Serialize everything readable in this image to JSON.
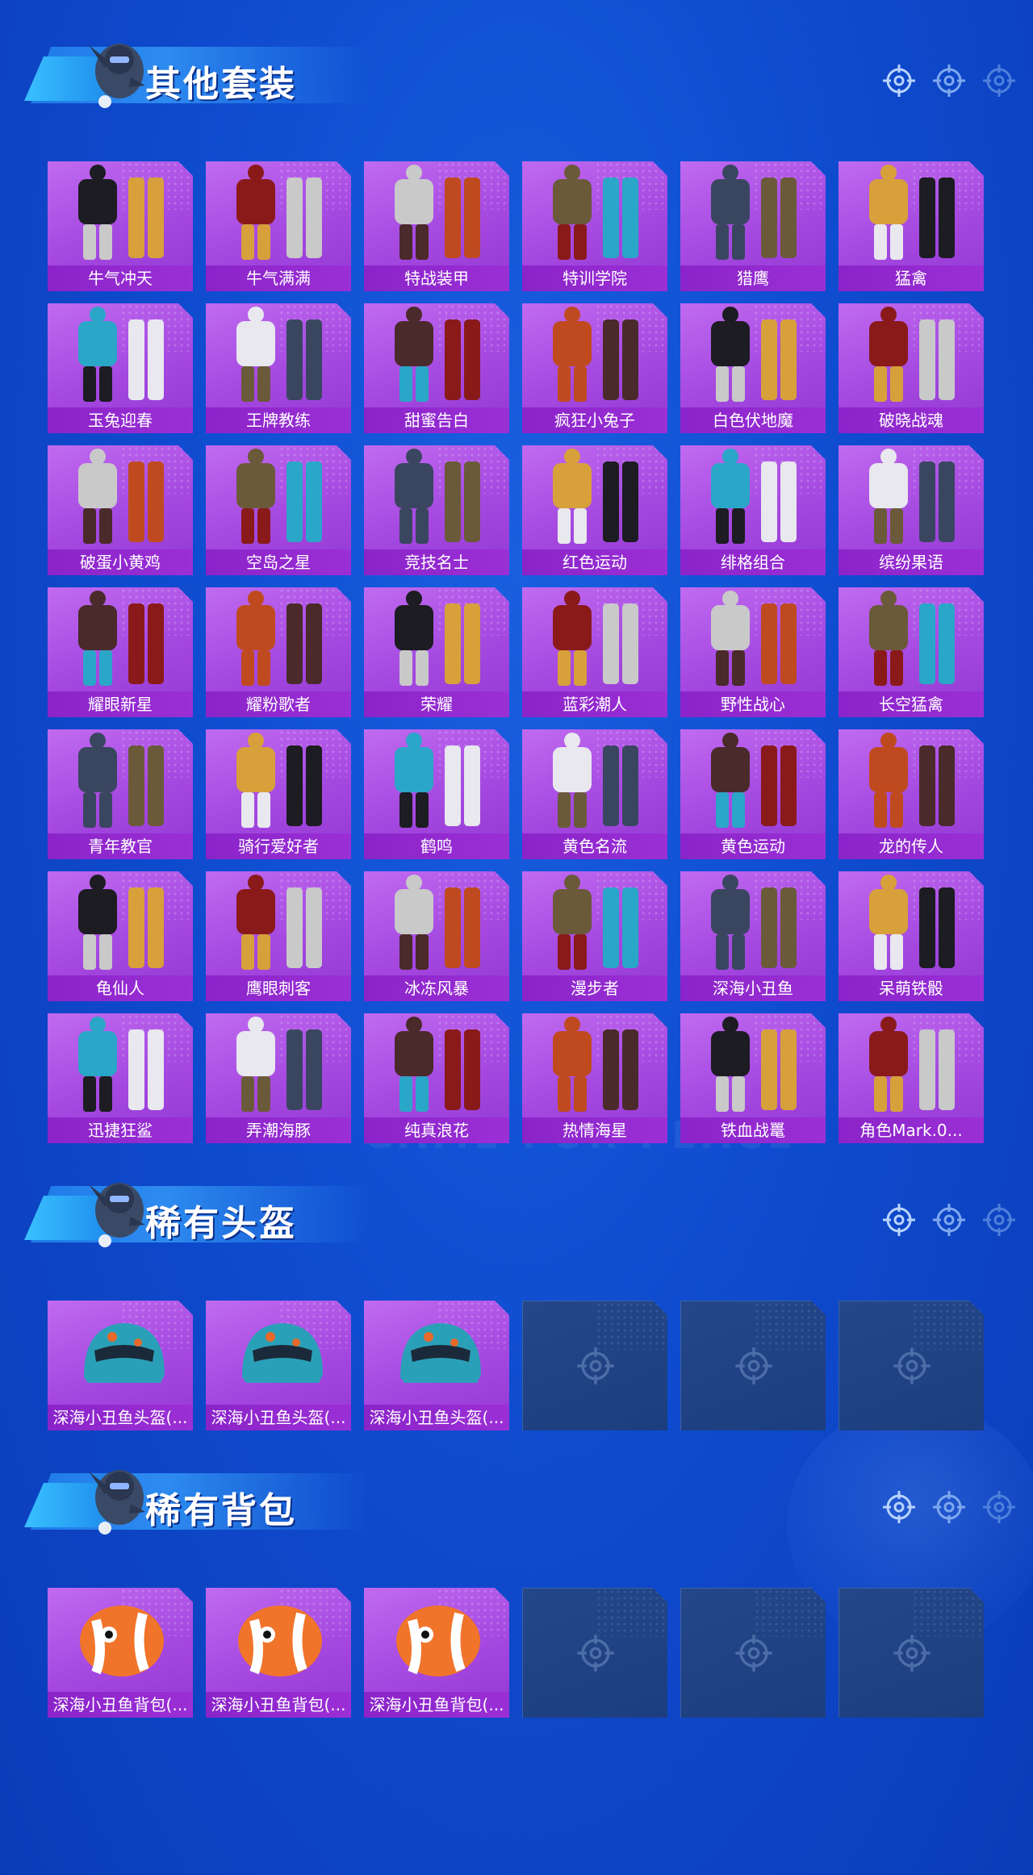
{
  "watermark": "GAME FOR PEACE",
  "sections": [
    {
      "title": "其他套装",
      "items": [
        "牛气冲天",
        "牛气满满",
        "特战装甲",
        "特训学院",
        "猎鹰",
        "猛禽",
        "玉兔迎春",
        "王牌教练",
        "甜蜜告白",
        "疯狂小兔子",
        "白色伏地魔",
        "破晓战魂",
        "破蛋小黄鸡",
        "空岛之星",
        "竞技名士",
        "红色运动",
        "绯格组合",
        "缤纷果语",
        "耀眼新星",
        "耀粉歌者",
        "荣耀",
        "蓝彩潮人",
        "野性战心",
        "长空猛禽",
        "青年教官",
        "骑行爱好者",
        "鹤鸣",
        "黄色名流",
        "黄色运动",
        "龙的传人",
        "龟仙人",
        "鹰眼刺客",
        "冰冻风暴",
        "漫步者",
        "深海小丑鱼",
        "呆萌铁骰",
        "迅捷狂鲨",
        "弄潮海豚",
        "纯真浪花",
        "热情海星",
        "铁血战鼍",
        "角色Mark.0..."
      ]
    },
    {
      "title": "稀有头盔",
      "items": [
        "深海小丑鱼头盔(...",
        "深海小丑鱼头盔(...",
        "深海小丑鱼头盔(..."
      ],
      "empty_slots": 3
    },
    {
      "title": "稀有背包",
      "items": [
        "深海小丑鱼背包(...",
        "深海小丑鱼背包(...",
        "深海小丑鱼背包(..."
      ],
      "empty_slots": 3
    }
  ],
  "colors": {
    "background": "#0f4cd0",
    "card_purple": "#a448e0",
    "label_purple": "#8a24c9",
    "empty_slot": "#1f4284"
  },
  "icons": {
    "section_decor": "crosshair-icon",
    "empty_slot": "crosshair-icon"
  }
}
